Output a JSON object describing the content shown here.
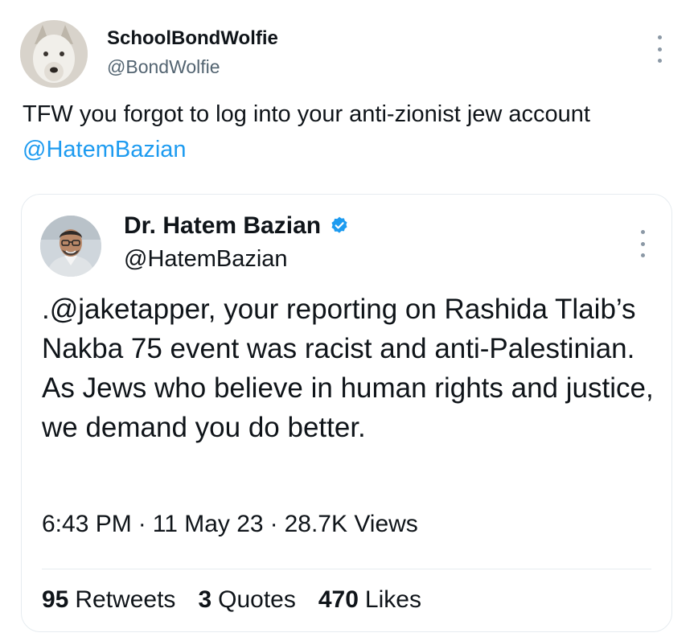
{
  "tweet": {
    "author_name": "SchoolBondWolfie",
    "author_handle": "@BondWolfie",
    "text": "TFW you forgot to log into your anti-zionist jew account ",
    "mention": "@HatemBazian",
    "avatar_icon": "wolf-avatar-icon",
    "more_icon": "more-options-icon"
  },
  "quoted_tweet": {
    "author_name": "Dr. Hatem Bazian",
    "author_handle": "@HatemBazian",
    "verified": true,
    "text": ".@jaketapper, your reporting on Rashida Tlaib’s Nakba 75 event was racist and anti-Palestinian. As Jews who believe in human rights and justice, we demand you do better.",
    "time": "6:43 PM",
    "date": "11 May 23",
    "views": "28.7K Views",
    "separator": "·",
    "stats": [
      {
        "count": "95",
        "label": "Retweets"
      },
      {
        "count": "3",
        "label": "Quotes"
      },
      {
        "count": "470",
        "label": "Likes"
      }
    ]
  },
  "colors": {
    "link": "#1d9bf0",
    "text": "#0f1419",
    "secondary": "#536471",
    "border": "#e6ecf0"
  }
}
